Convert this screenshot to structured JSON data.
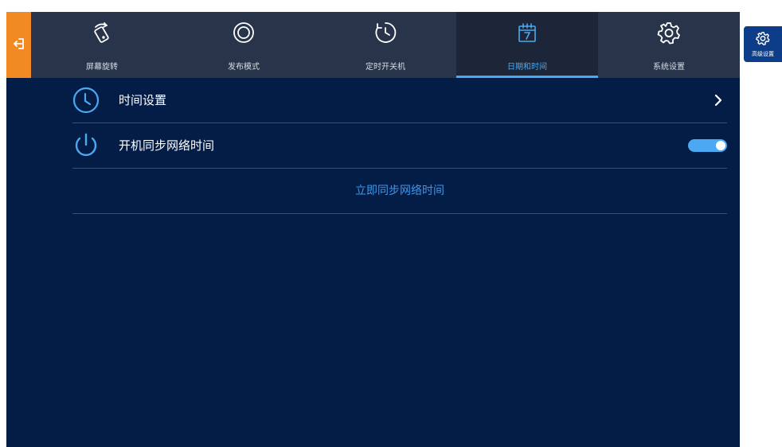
{
  "back": {
    "icon": "exit-arrow-icon"
  },
  "tabs": [
    {
      "label": "屏幕旋转",
      "icon": "screen-rotate-icon",
      "active": false
    },
    {
      "label": "发布模式",
      "icon": "publish-mode-icon",
      "active": false
    },
    {
      "label": "定时开关机",
      "icon": "timer-power-icon",
      "active": false
    },
    {
      "label": "日期和时间",
      "icon": "calendar-icon",
      "active": true
    },
    {
      "label": "系统设置",
      "icon": "gear-icon",
      "active": false
    }
  ],
  "rows": {
    "time_settings": {
      "label": "时间设置",
      "icon": "clock-icon"
    },
    "boot_sync": {
      "label": "开机同步网络时间",
      "icon": "power-icon",
      "toggle_on": true
    },
    "sync_now": {
      "label": "立即同步网络时间"
    }
  },
  "advanced": {
    "label": "高级设置",
    "icon": "advanced-settings-icon"
  },
  "colors": {
    "background": "#041d47",
    "topbar": "#273449",
    "accent": "#4aa9f2",
    "back_button": "#f28a23",
    "advanced_button": "#0d3d89"
  }
}
